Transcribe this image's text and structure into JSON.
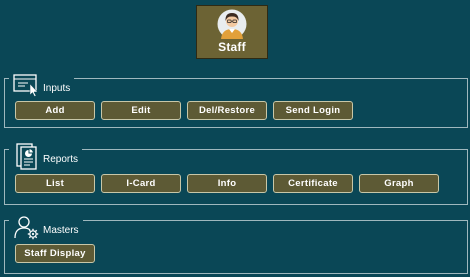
{
  "header": {
    "avatar_label": "Staff",
    "avatar_icon": "staff-avatar-icon",
    "tile_color": "#6c6334"
  },
  "groups": {
    "inputs": {
      "title": "Inputs",
      "icon": "form-cursor-icon",
      "buttons": [
        "Add",
        "Edit",
        "Del/Restore",
        "Send Login"
      ]
    },
    "reports": {
      "title": "Reports",
      "icon": "report-document-icon",
      "buttons": [
        "List",
        "I-Card",
        "Info",
        "Certificate",
        "Graph"
      ]
    },
    "masters": {
      "title": "Masters",
      "icon": "user-settings-icon",
      "buttons": [
        "Staff Display"
      ]
    }
  },
  "colors": {
    "background": "#0a4756",
    "button": "#5d5a35",
    "button_border": "#c8c7a8"
  }
}
